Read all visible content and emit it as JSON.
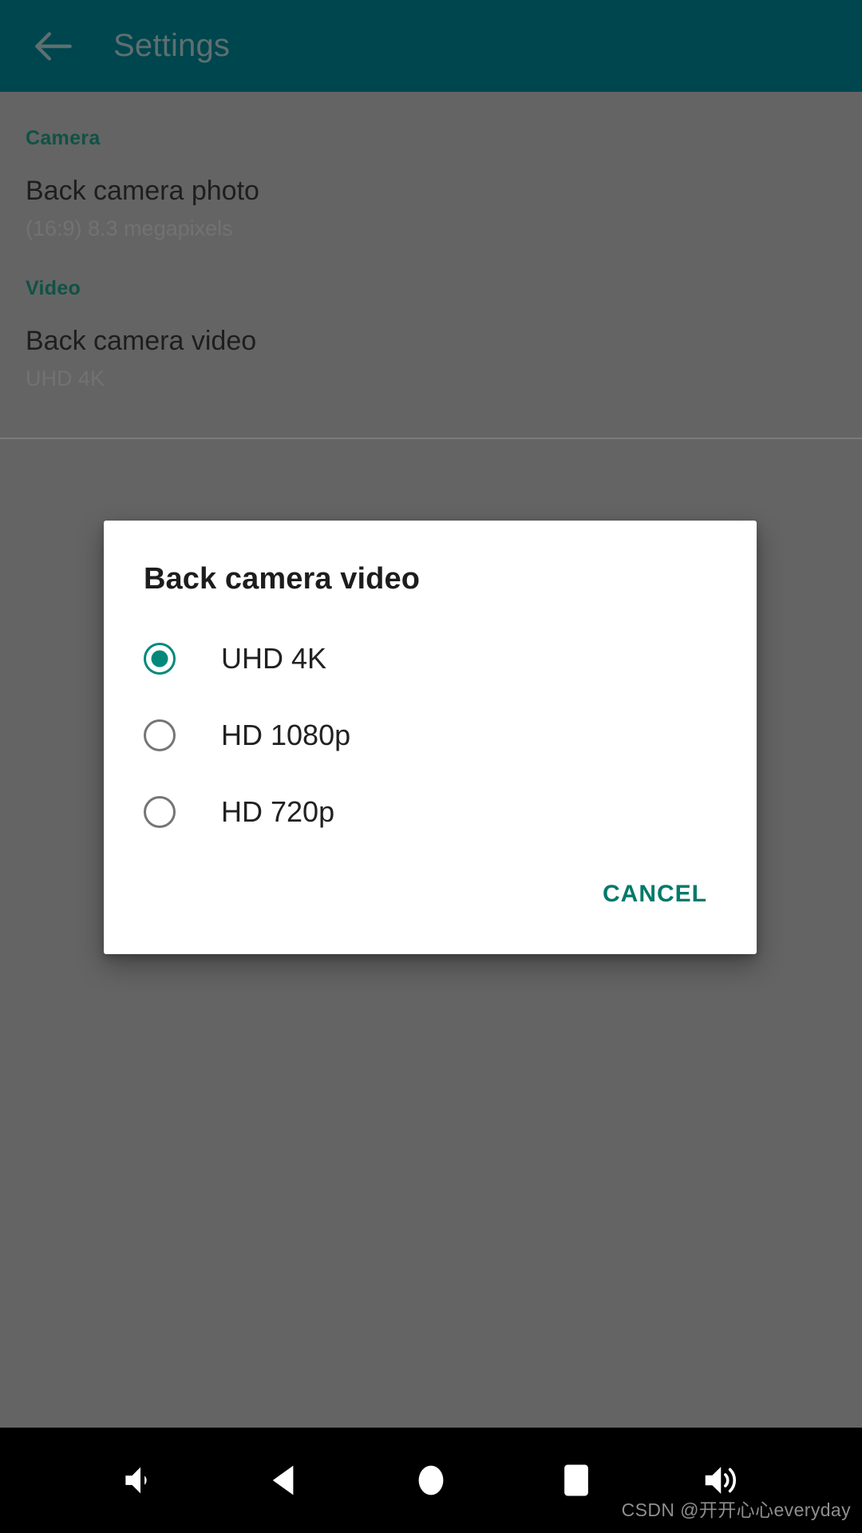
{
  "appbar": {
    "back_icon": "arrow-left-icon",
    "title": "Settings",
    "background_color": "#00464e",
    "title_color": "#5e6f70"
  },
  "settings": {
    "accent_color": "#0f5245",
    "sections": [
      {
        "header": "Camera",
        "items": [
          {
            "title": "Back camera photo",
            "summary": "(16:9) 8.3 megapixels"
          }
        ]
      },
      {
        "header": "Video",
        "items": [
          {
            "title": "Back camera video",
            "summary": "UHD 4K"
          }
        ]
      }
    ]
  },
  "dialog": {
    "title": "Back camera video",
    "accent_color": "#00897b",
    "options": [
      {
        "label": "UHD 4K",
        "selected": true
      },
      {
        "label": "HD 1080p",
        "selected": false
      },
      {
        "label": "HD 720p",
        "selected": false
      }
    ],
    "cancel_label": "CANCEL",
    "cancel_color": "#00796b"
  },
  "navbar": {
    "background_color": "#000000",
    "buttons": [
      {
        "icon": "volume-down-icon"
      },
      {
        "icon": "back-triangle-icon"
      },
      {
        "icon": "home-circle-icon"
      },
      {
        "icon": "recents-square-icon"
      },
      {
        "icon": "volume-up-icon"
      }
    ],
    "watermark": "CSDN @开开心心everyday"
  }
}
